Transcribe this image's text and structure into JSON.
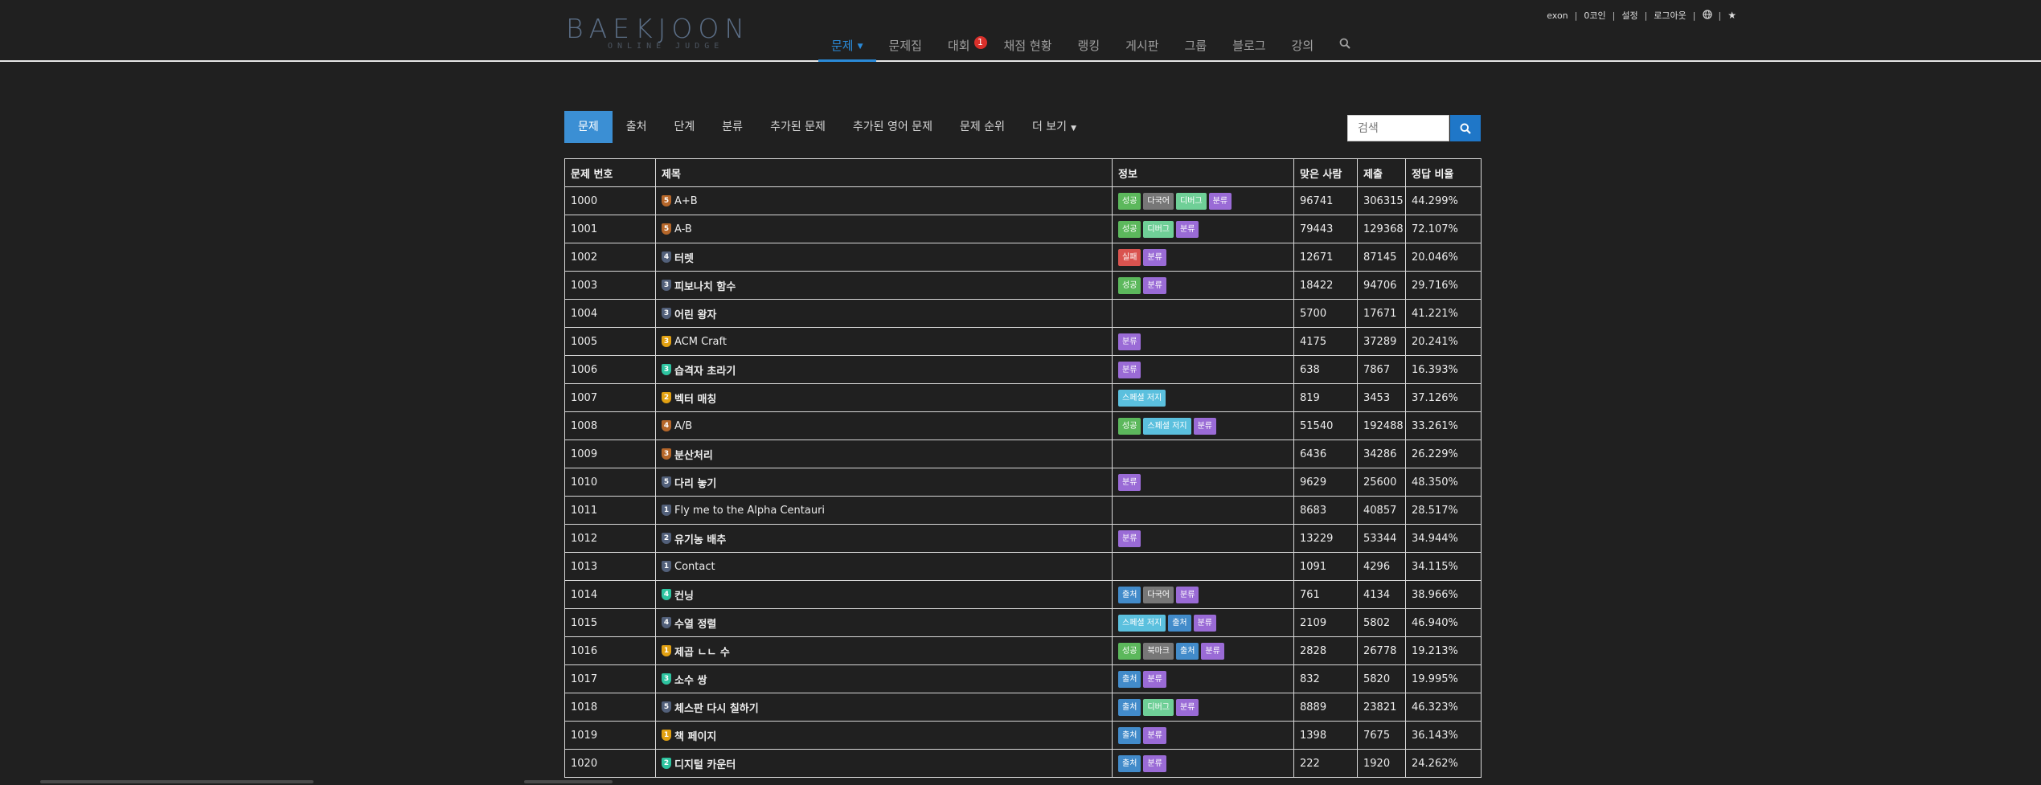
{
  "header": {
    "logo_main": "BAEKJOON",
    "logo_sub": "ONLINE JUDGE",
    "topbar": {
      "user": "exon",
      "coins": "0코인",
      "settings": "설정",
      "logout": "로그아웃"
    },
    "nav": [
      {
        "label": "문제",
        "active": true
      },
      {
        "label": "문제집"
      },
      {
        "label": "대회",
        "badge": "1"
      },
      {
        "label": "채점 현황"
      },
      {
        "label": "랭킹"
      },
      {
        "label": "게시판"
      },
      {
        "label": "그룹"
      },
      {
        "label": "블로그"
      },
      {
        "label": "강의"
      }
    ]
  },
  "tabs": [
    "문제",
    "출처",
    "단계",
    "분류",
    "추가된 문제",
    "추가된 영어 문제",
    "문제 순위",
    "더 보기"
  ],
  "search": {
    "placeholder": "검색"
  },
  "table": {
    "headers": [
      "문제 번호",
      "제목",
      "정보",
      "맞은 사람",
      "제출",
      "정답 비율"
    ],
    "tag_labels": {
      "success": "성공",
      "multi": "다국어",
      "diff": "디버그",
      "category": "분류",
      "fail": "실패",
      "special": "스페셜 저지",
      "source": "출처",
      "bookmark": "북마크"
    },
    "rows": [
      {
        "id": "1000",
        "title": "A+B",
        "tier": "bronze",
        "tier_num": "5",
        "tags": [
          "success",
          "multi",
          "diff",
          "category"
        ],
        "solved": "96741",
        "submit": "306315",
        "ratio": "44.299%"
      },
      {
        "id": "1001",
        "title": "A-B",
        "tier": "bronze",
        "tier_num": "5",
        "tags": [
          "success",
          "diff",
          "category"
        ],
        "solved": "79443",
        "submit": "129368",
        "ratio": "72.107%"
      },
      {
        "id": "1002",
        "title": "터렛",
        "tier": "silver",
        "tier_num": "4",
        "tags": [
          "fail",
          "category"
        ],
        "solved": "12671",
        "submit": "87145",
        "ratio": "20.046%"
      },
      {
        "id": "1003",
        "title": "피보나치 함수",
        "tier": "silver",
        "tier_num": "3",
        "tags": [
          "success",
          "category"
        ],
        "solved": "18422",
        "submit": "94706",
        "ratio": "29.716%"
      },
      {
        "id": "1004",
        "title": "어린 왕자",
        "tier": "silver",
        "tier_num": "3",
        "tags": [],
        "solved": "5700",
        "submit": "17671",
        "ratio": "41.221%"
      },
      {
        "id": "1005",
        "title": "ACM Craft",
        "tier": "gold",
        "tier_num": "3",
        "tags": [
          "category"
        ],
        "solved": "4175",
        "submit": "37289",
        "ratio": "20.241%"
      },
      {
        "id": "1006",
        "title": "습격자 초라기",
        "tier": "plat",
        "tier_num": "3",
        "tags": [
          "category"
        ],
        "solved": "638",
        "submit": "7867",
        "ratio": "16.393%"
      },
      {
        "id": "1007",
        "title": "벡터 매칭",
        "tier": "gold",
        "tier_num": "2",
        "tags": [
          "special"
        ],
        "solved": "819",
        "submit": "3453",
        "ratio": "37.126%"
      },
      {
        "id": "1008",
        "title": "A/B",
        "tier": "bronze",
        "tier_num": "4",
        "tags": [
          "success",
          "special",
          "category"
        ],
        "solved": "51540",
        "submit": "192488",
        "ratio": "33.261%"
      },
      {
        "id": "1009",
        "title": "분산처리",
        "tier": "bronze",
        "tier_num": "3",
        "tags": [],
        "solved": "6436",
        "submit": "34286",
        "ratio": "26.229%"
      },
      {
        "id": "1010",
        "title": "다리 놓기",
        "tier": "silver",
        "tier_num": "5",
        "tags": [
          "category"
        ],
        "solved": "9629",
        "submit": "25600",
        "ratio": "48.350%"
      },
      {
        "id": "1011",
        "title": "Fly me to the Alpha Centauri",
        "tier": "silver",
        "tier_num": "1",
        "tags": [],
        "solved": "8683",
        "submit": "40857",
        "ratio": "28.517%"
      },
      {
        "id": "1012",
        "title": "유기농 배추",
        "tier": "silver",
        "tier_num": "2",
        "tags": [
          "category"
        ],
        "solved": "13229",
        "submit": "53344",
        "ratio": "34.944%"
      },
      {
        "id": "1013",
        "title": "Contact",
        "tier": "silver",
        "tier_num": "1",
        "tags": [],
        "solved": "1091",
        "submit": "4296",
        "ratio": "34.115%"
      },
      {
        "id": "1014",
        "title": "컨닝",
        "tier": "plat",
        "tier_num": "4",
        "tags": [
          "source",
          "multi",
          "category"
        ],
        "solved": "761",
        "submit": "4134",
        "ratio": "38.966%"
      },
      {
        "id": "1015",
        "title": "수열 정렬",
        "tier": "silver",
        "tier_num": "4",
        "tags": [
          "special",
          "source",
          "category"
        ],
        "solved": "2109",
        "submit": "5802",
        "ratio": "46.940%"
      },
      {
        "id": "1016",
        "title": "제곱 ㄴㄴ 수",
        "tier": "gold",
        "tier_num": "1",
        "tags": [
          "success",
          "bookmark",
          "source",
          "category"
        ],
        "solved": "2828",
        "submit": "26778",
        "ratio": "19.213%"
      },
      {
        "id": "1017",
        "title": "소수 쌍",
        "tier": "plat",
        "tier_num": "3",
        "tags": [
          "source",
          "category"
        ],
        "solved": "832",
        "submit": "5820",
        "ratio": "19.995%"
      },
      {
        "id": "1018",
        "title": "체스판 다시 칠하기",
        "tier": "silver",
        "tier_num": "5",
        "tags": [
          "source",
          "diff",
          "category"
        ],
        "solved": "8889",
        "submit": "23821",
        "ratio": "46.323%"
      },
      {
        "id": "1019",
        "title": "책 페이지",
        "tier": "gold",
        "tier_num": "1",
        "tags": [
          "source",
          "category"
        ],
        "solved": "1398",
        "submit": "7675",
        "ratio": "36.143%"
      },
      {
        "id": "1020",
        "title": "디지털 카운터",
        "tier": "plat",
        "tier_num": "2",
        "tags": [
          "source",
          "category"
        ],
        "solved": "222",
        "submit": "1920",
        "ratio": "24.262%"
      }
    ]
  },
  "colors": {
    "background": "#202020",
    "accent": "#2a8ad8",
    "badge": "#d9302b"
  }
}
